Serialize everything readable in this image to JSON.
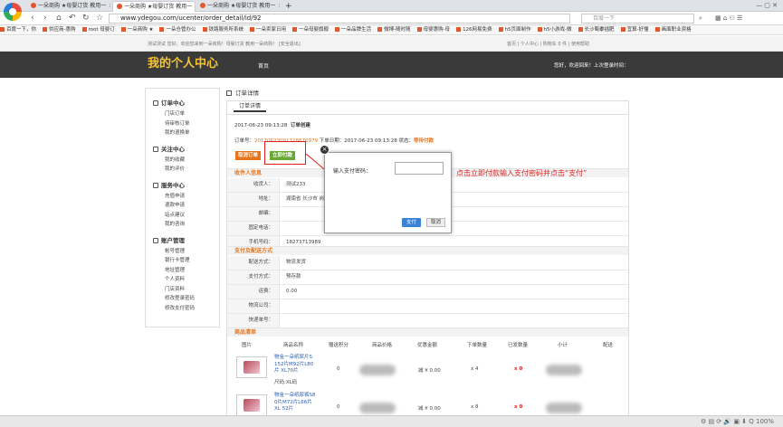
{
  "browser": {
    "tabs": [
      {
        "label": "一朵商购 ★母婴订货 教用一"
      },
      {
        "label": "一朵商购 ★母婴订货 教用一"
      },
      {
        "label": "一朵商购 ★母婴订货 教用一"
      }
    ],
    "new_tab": "+",
    "url": "www.ydegou.com/ucenter/order_detail/id/92",
    "search_placeholder": "百度一下",
    "bookmarks": [
      "百度一下，你",
      "供应商-惠购",
      "root 母婴订",
      "一朵商购 ★",
      "一朵仓管办公",
      "铁路服务所系统",
      "一朵卖家日用",
      "一朵母婴旗舰",
      "一朵品牌生活",
      "微博-随时随",
      "母婴惠购-母",
      "126网易免费",
      "h5页面制作",
      "h5小游戏-微",
      "长沙蜀黍插肥",
      "宜算-好懂",
      "画面职业资格"
    ]
  },
  "topbar": {
    "left": "测试测试 您好，欢迎您来到一朵商购！母婴订货 教用一朵商购！ [安全退出]",
    "right": "首页 | 个人中心 | 购物车 0 件 | 使用帮助"
  },
  "header": {
    "title": "我的个人中心",
    "home": "首页",
    "welcome": "您好，欢迎回来！上次登录时间："
  },
  "sidebar": {
    "sections": [
      {
        "title": "订单中心",
        "items": [
          "门店订单",
          "待审核订单",
          "我的退换单"
        ]
      },
      {
        "title": "关注中心",
        "items": [
          "我的收藏",
          "我的评价"
        ]
      },
      {
        "title": "服务中心",
        "items": [
          "充值申请",
          "退款申请",
          "站点建议",
          "我的咨询"
        ]
      },
      {
        "title": "账户管理",
        "items": [
          "帐号管理",
          "银行卡管理",
          "地址管理",
          "个人资料",
          "门店资料",
          "修改登录密码",
          "修改支付密码"
        ]
      }
    ]
  },
  "content": {
    "crumb": "订单详情",
    "tab": "订单详情",
    "created": "2017-06-23 09:13:28",
    "created_status": "订单创建",
    "order_no_label": "订单号：",
    "order_no": "2017062309132867697​9",
    "order_time_label": "下单日期：",
    "order_time": "2017-06-23 09:13:28",
    "status_label": "状态：",
    "status": "等待付款",
    "cancel_btn": "取消订单",
    "pay_btn": "立即付款",
    "receiver_section": "收件人信息",
    "receiver_rows": [
      {
        "label": "收货人：",
        "value": "测试233"
      },
      {
        "label": "地址：",
        "value": "湖南省 长沙市 岗"
      },
      {
        "label": "邮编：",
        "value": ""
      },
      {
        "label": "固定电话：",
        "value": ""
      },
      {
        "label": "手机号码：",
        "value": "18273713989"
      }
    ],
    "pay_section": "支付及配送方式",
    "pay_rows": [
      {
        "label": "配送方式：",
        "value": "物流发货"
      },
      {
        "label": "支付方式：",
        "value": "预存款"
      },
      {
        "label": "运费：",
        "value": "0.00"
      },
      {
        "label": "物流公司：",
        "value": ""
      },
      {
        "label": "快递单号：",
        "value": ""
      }
    ],
    "goods_section": "商品清单",
    "goods_headers": [
      "图片",
      "商品名称",
      "赠送积分",
      "商品价格",
      "优惠金额",
      "下单数量",
      "已发数量",
      "小计",
      "配送"
    ],
    "goods": [
      {
        "name": "物金一朵纸尿片S 152片M92片L80片 XL70片",
        "spec": "尺码:XL码",
        "points": "0",
        "discount": "减 ¥ 0.00",
        "qty": "x 4",
        "sent": "x 0"
      },
      {
        "name": "物金一朵纸尿裤S8 0片M72片L66片XL 52片",
        "spec": "",
        "points": "0",
        "discount": "减 ¥ 0.00",
        "qty": "x 8",
        "sent": "x 0"
      }
    ]
  },
  "dialog": {
    "label": "输入支付密码：",
    "password_value": "",
    "pay": "支付",
    "cancel": "取消",
    "close": "×"
  },
  "annotation": "点击立即付款输入支付密码并点击“支付”",
  "colors": {
    "header_bg": "#3a3a3a",
    "title": "#f6c531",
    "accent": "#e5741d",
    "pay_btn": "#6aa832",
    "dialog_btn": "#3b82d4",
    "annotation": "#e02020"
  }
}
